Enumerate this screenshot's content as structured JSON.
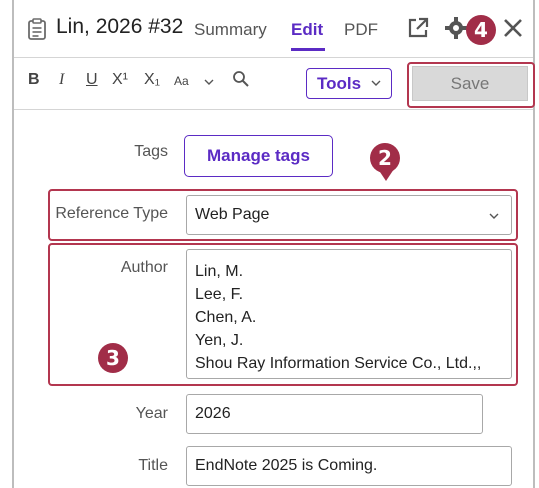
{
  "header": {
    "reference_title": "Lin, 2026 #32",
    "tabs": [
      {
        "label": "Summary",
        "active": false
      },
      {
        "label": "Edit",
        "active": true
      },
      {
        "label": "PDF",
        "active": false
      }
    ],
    "icons": [
      "clipboard-icon",
      "open-external-icon",
      "gear-icon",
      "close-icon"
    ]
  },
  "toolbar": {
    "bold": "B",
    "italic": "I",
    "underline": "U",
    "superscript": "X¹",
    "subscript": "X₁",
    "font_size": "Aa",
    "tools_label": "Tools",
    "save_label": "Save"
  },
  "form": {
    "tags": {
      "label": "Tags",
      "button": "Manage tags"
    },
    "reference_type": {
      "label": "Reference Type",
      "value": "Web Page"
    },
    "author": {
      "label": "Author",
      "lines": [
        "Lin, M.",
        "Lee, F.",
        "Chen, A.",
        "Yen, J.",
        "Shou Ray Information Service Co., Ltd.,,"
      ]
    },
    "year": {
      "label": "Year",
      "value": "2026"
    },
    "title": {
      "label": "Title",
      "value": "EndNote 2025 is Coming."
    }
  },
  "annotations": {
    "markers": [
      "4",
      "2",
      "3"
    ],
    "color": "#a12d48"
  },
  "colors": {
    "accent": "#5b2bc4",
    "highlight": "#b3364f"
  }
}
